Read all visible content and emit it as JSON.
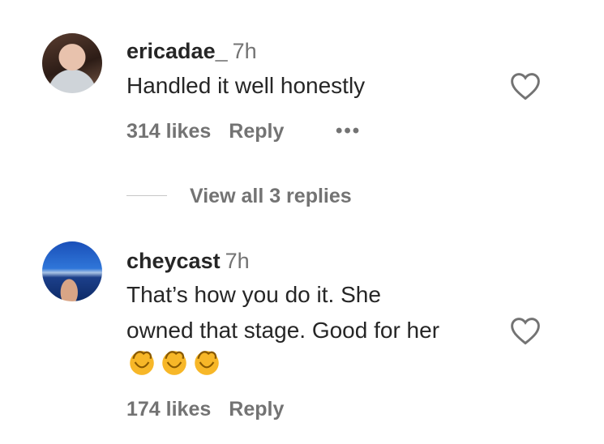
{
  "comments": [
    {
      "username": "ericadae_",
      "time": "7h",
      "text": "Handled it well honestly",
      "likes": "314 likes",
      "reply_label": "Reply",
      "more_label": "•••"
    },
    {
      "username": "cheycast",
      "time": "7h",
      "text_line1": "That’s how you do it. She",
      "text_line2": "owned that stage. Good for her",
      "emoji": "👏👏👏",
      "likes": "174 likes",
      "reply_label": "Reply"
    }
  ],
  "view_replies_label": "View all 3 replies",
  "icons": {
    "heart": "heart-outline-icon",
    "clap": "clapping-hands-emoji"
  },
  "colors": {
    "text": "#262626",
    "secondary": "#737373",
    "divider": "#c7c7c7"
  }
}
